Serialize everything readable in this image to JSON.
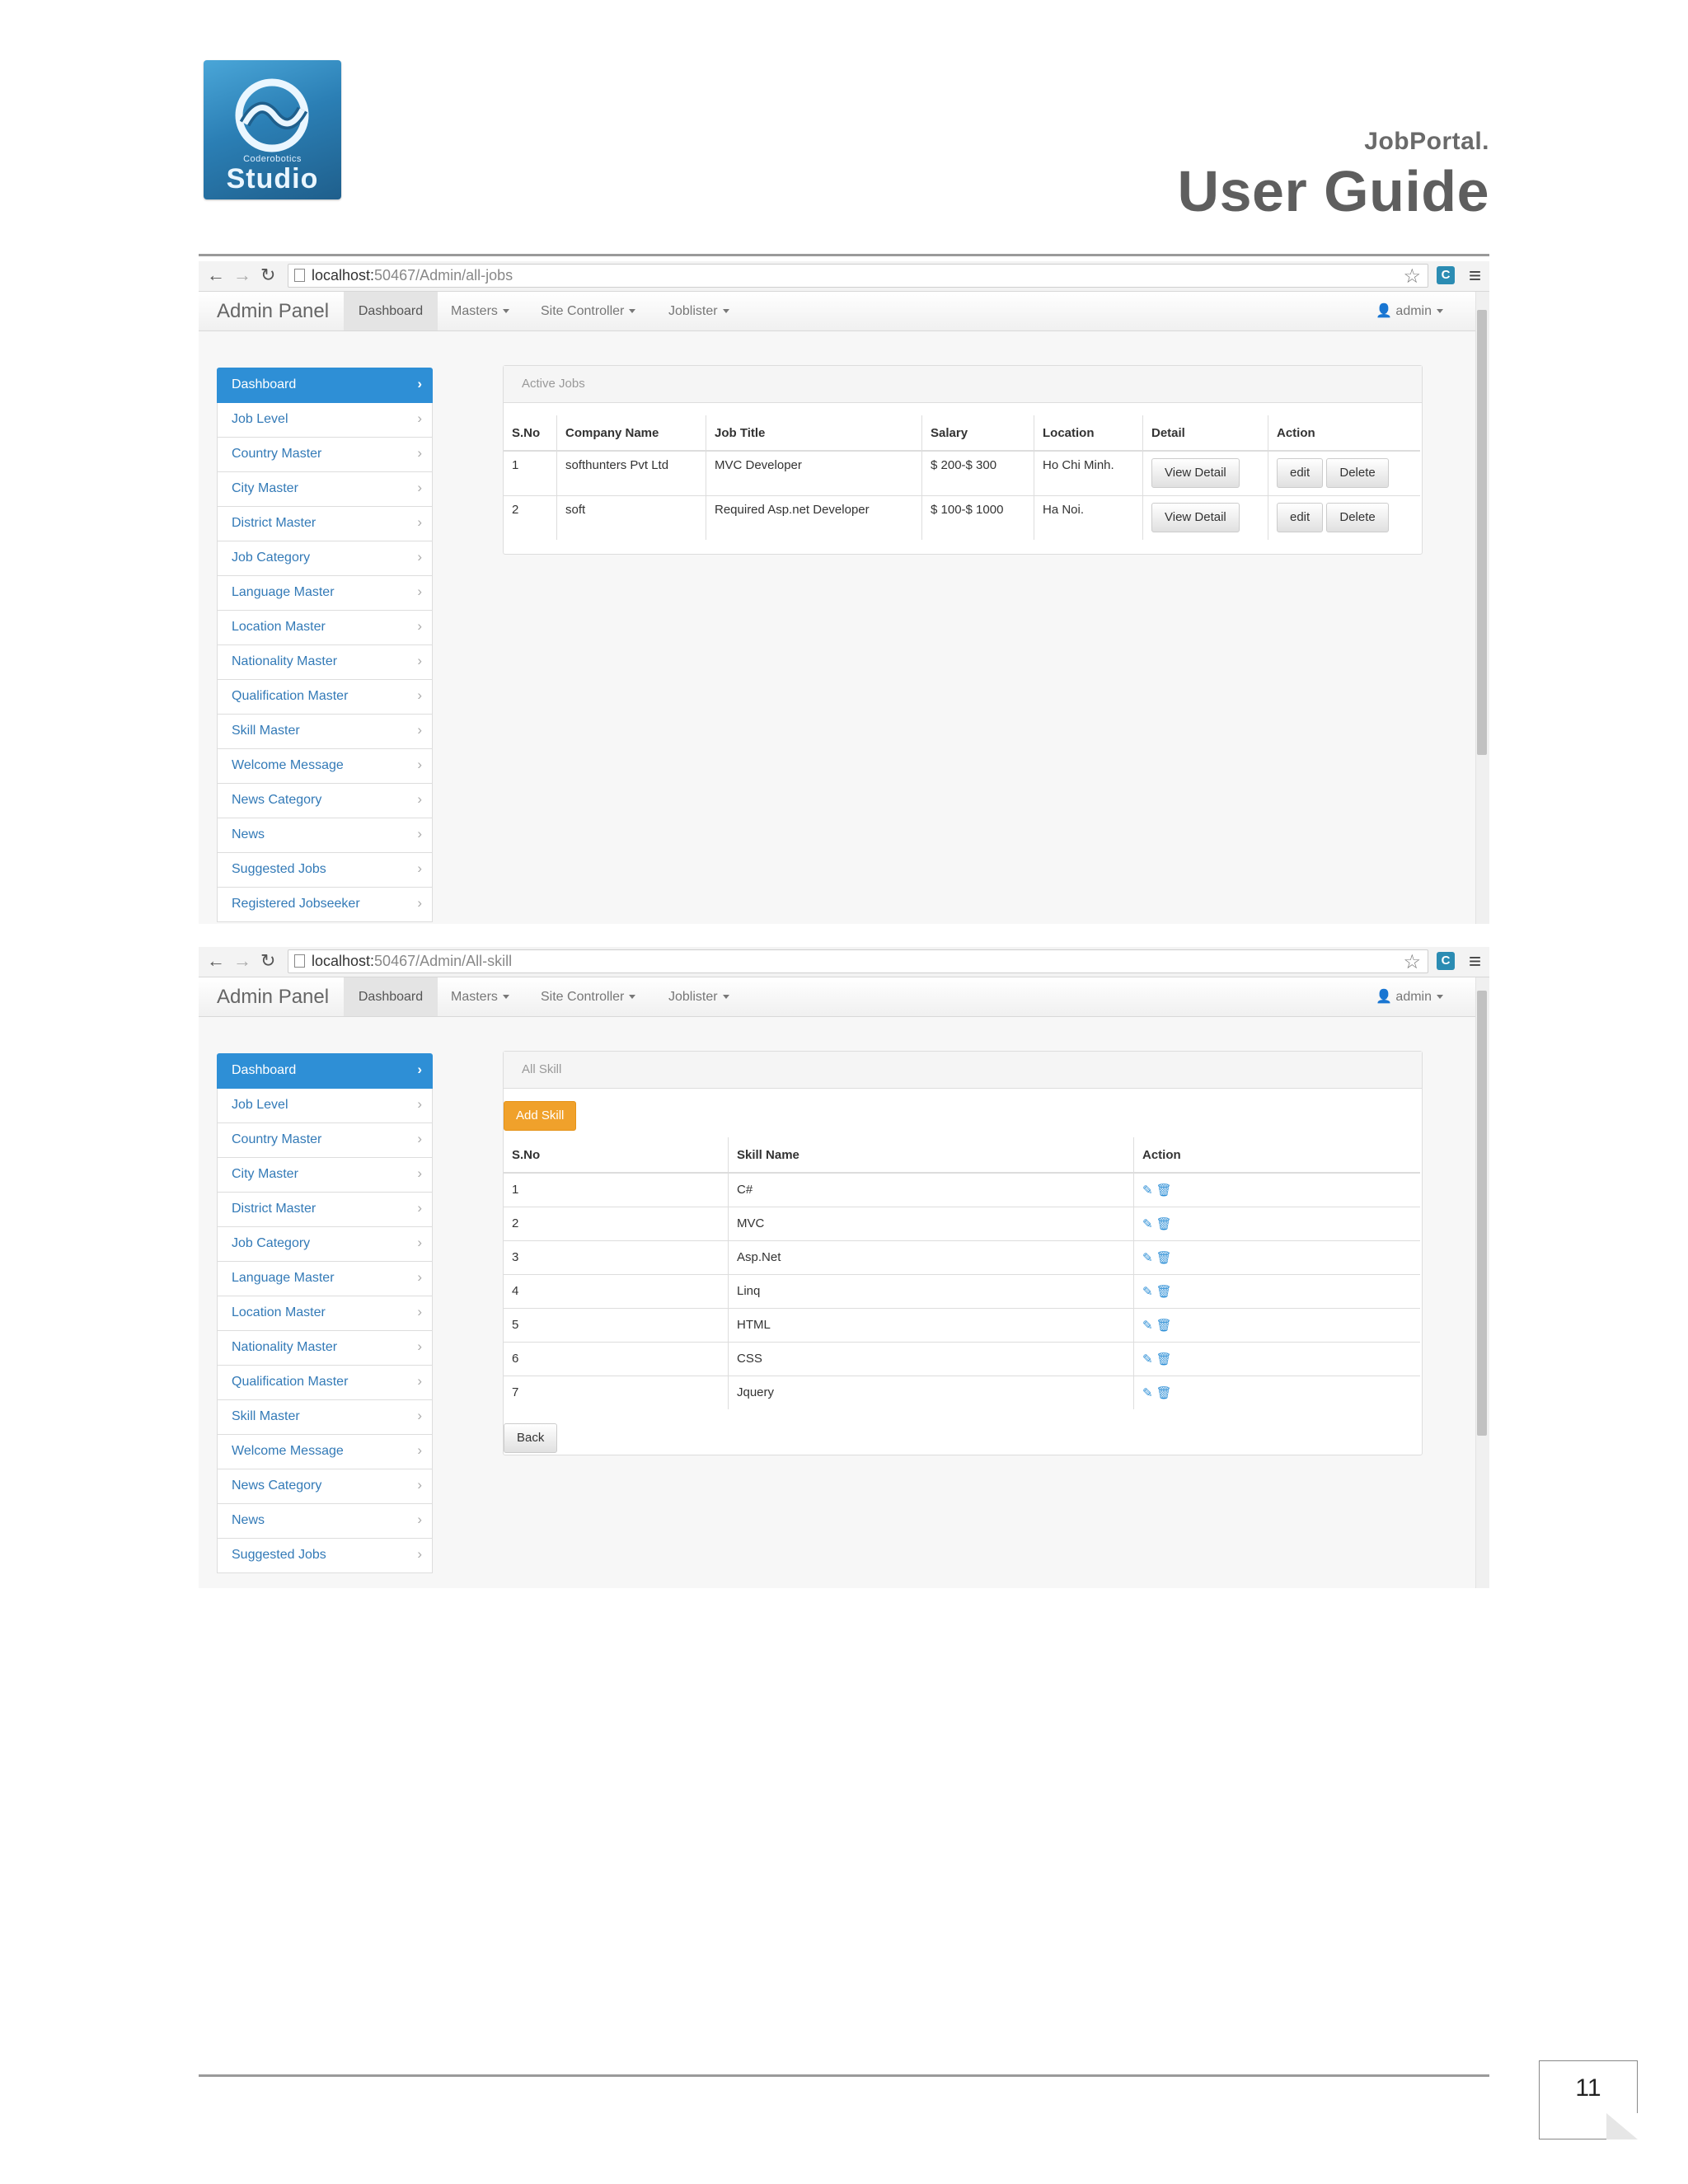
{
  "header": {
    "logo_small_text": "Coderobotics",
    "logo_text": "Studio",
    "brand_subtitle": "JobPortal.",
    "brand_title": "User Guide"
  },
  "screen1": {
    "url_host": "localhost:",
    "url_path": "50467/Admin/all-jobs",
    "navbar": {
      "brand": "Admin Panel",
      "items": [
        "Dashboard",
        "Masters",
        "Site Controller",
        "Joblister"
      ],
      "user": "admin"
    },
    "sidebar": [
      "Dashboard",
      "Job Level",
      "Country Master",
      "City Master",
      "District Master",
      "Job Category",
      "Language Master",
      "Location Master",
      "Nationality Master",
      "Qualification Master",
      "Skill Master",
      "Welcome Message",
      "News Category",
      "News",
      "Suggested Jobs",
      "Registered Jobseeker"
    ],
    "panel_title": "Active Jobs",
    "table": {
      "headers": [
        "S.No",
        "Company Name",
        "Job Title",
        "Salary",
        "Location",
        "Detail",
        "Action"
      ],
      "rows": [
        {
          "sno": "1",
          "company": "softhunters Pvt Ltd",
          "title": "MVC Developer",
          "salary": "$ 200-$ 300",
          "location": "Ho Chi Minh."
        },
        {
          "sno": "2",
          "company": "soft",
          "title": "Required Asp.net Developer",
          "salary": "$ 100-$ 1000",
          "location": "Ha Noi."
        }
      ],
      "detail_button": "View Detail",
      "edit_button": "edit",
      "delete_button": "Delete"
    }
  },
  "screen2": {
    "url_host": "localhost:",
    "url_path": "50467/Admin/All-skill",
    "navbar": {
      "brand": "Admin Panel",
      "items": [
        "Dashboard",
        "Masters",
        "Site Controller",
        "Joblister"
      ],
      "user": "admin"
    },
    "sidebar": [
      "Dashboard",
      "Job Level",
      "Country Master",
      "City Master",
      "District Master",
      "Job Category",
      "Language Master",
      "Location Master",
      "Nationality Master",
      "Qualification Master",
      "Skill Master",
      "Welcome Message",
      "News Category",
      "News",
      "Suggested Jobs"
    ],
    "panel_title": "All Skill",
    "add_button": "Add Skill",
    "table": {
      "headers": [
        "S.No",
        "Skill Name",
        "Action"
      ],
      "rows": [
        {
          "sno": "1",
          "skill": "C#"
        },
        {
          "sno": "2",
          "skill": "MVC"
        },
        {
          "sno": "3",
          "skill": "Asp.Net"
        },
        {
          "sno": "4",
          "skill": "Linq"
        },
        {
          "sno": "5",
          "skill": "HTML"
        },
        {
          "sno": "6",
          "skill": "CSS"
        },
        {
          "sno": "7",
          "skill": "Jquery"
        }
      ]
    },
    "back_button": "Back"
  },
  "footer": {
    "page_number": "11"
  }
}
